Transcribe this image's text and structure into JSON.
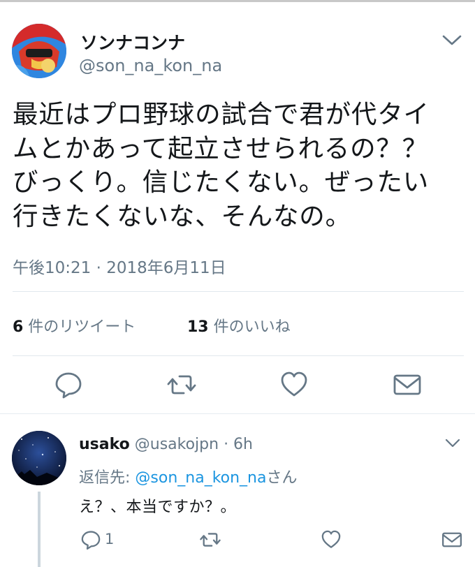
{
  "tweet": {
    "display_name": "ソンナコンナ",
    "handle": "@son_na_kon_na",
    "lines": [
      "最近はプロ野球の試合で君が代タイ",
      "ムとかあって起立させられるの？？",
      "びっくり。信じたくない。ぜったい",
      "行きたくないな、そんなの。"
    ],
    "timestamp": "午後10:21 · 2018年6月11日",
    "retweet_count": "6",
    "retweet_label": " 件のリツイート",
    "like_count": "13",
    "like_label": " 件のいいね"
  },
  "reply": {
    "display_name": "usako",
    "meta": " @usakojpn · 6h",
    "replying_prefix": "返信先: ",
    "replying_mention": "@son_na_kon_na",
    "replying_suffix": "さん",
    "text": "え？、本当ですか？。",
    "reply_count": "1"
  },
  "icons": {
    "chevron": "chevron-down-icon",
    "reply": "reply-icon",
    "retweet": "retweet-icon",
    "like": "heart-icon",
    "message": "envelope-icon"
  },
  "colors": {
    "text": "#14171a",
    "secondary": "#657786",
    "link": "#1b95e0",
    "divider": "#e1e8ed"
  }
}
